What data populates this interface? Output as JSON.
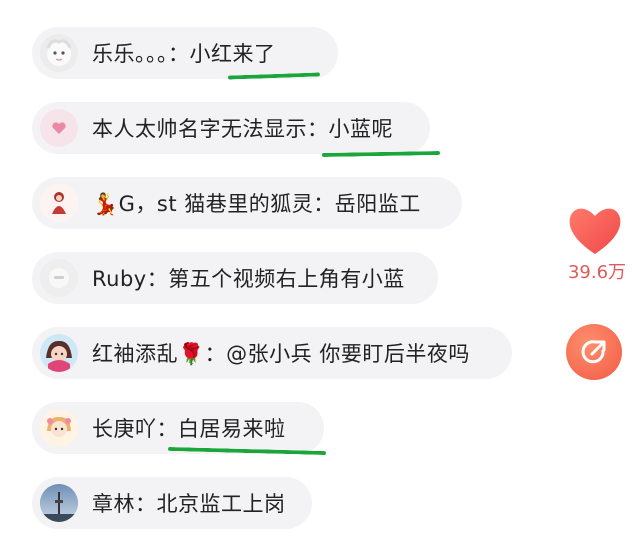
{
  "comments": [
    {
      "name": "乐乐。。。",
      "sep": "：",
      "text": "小红来了",
      "avatar": "white-fluffy-avatar"
    },
    {
      "name": "本人太帅名字无法显示",
      "sep": "：",
      "text": "小蓝呢",
      "avatar": "pink-heart-avatar"
    },
    {
      "name": "💃G，st 猫巷里的狐灵",
      "sep": "：",
      "text": "岳阳监工",
      "avatar": "red-figure-avatar"
    },
    {
      "name": "Ruby",
      "sep": "：",
      "text": "第五个视频右上角有小蓝",
      "avatar": "gray-logo-avatar"
    },
    {
      "name": "红袖添乱🌹",
      "sep": "：",
      "text": "@张小兵 你要盯后半夜吗",
      "avatar": "cartoon-girl-avatar"
    },
    {
      "name": "长庚吖",
      "sep": "：",
      "text": "白居易来啦",
      "avatar": "anime-girl-avatar"
    },
    {
      "name": "章林",
      "sep": "：",
      "text": "北京监工上岗",
      "avatar": "tower-photo-avatar"
    }
  ],
  "like": {
    "count": "39.6万",
    "icon": "heart-icon",
    "color": "#f5564e"
  },
  "share": {
    "icon": "share-icon",
    "color": "#f15a45"
  },
  "highlight_color": "#1aa63a"
}
